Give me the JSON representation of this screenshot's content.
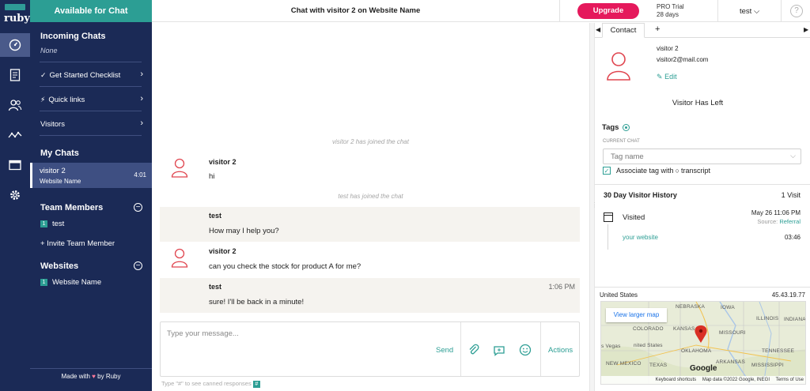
{
  "brand": {
    "badge": "",
    "name": "ruby"
  },
  "sidebar": {
    "header": "Available for Chat",
    "incoming_title": "Incoming Chats",
    "incoming_empty": "None",
    "menu": [
      {
        "label": "Get Started Checklist",
        "icon": "check-icon"
      },
      {
        "label": "Quick links",
        "icon": "bolt-icon"
      },
      {
        "label": "Visitors",
        "icon": ""
      }
    ],
    "my_chats_title": "My Chats",
    "active_chat": {
      "name": "visitor 2",
      "site": "Website Name",
      "time": "4:01"
    },
    "team_title": "Team Members",
    "team": [
      {
        "name": "test",
        "badge": "1"
      }
    ],
    "invite_label": "+ Invite Team Member",
    "websites_title": "Websites",
    "websites": [
      {
        "name": "Website Name",
        "badge": "1"
      }
    ],
    "footer_made": "Made with",
    "footer_by": "by Ruby"
  },
  "topbar": {
    "chat_title": "Chat with visitor 2 on Website Name",
    "upgrade_label": "Upgrade",
    "plan": "PRO Trial",
    "trial_days": "28 days",
    "user": "test",
    "help": "?"
  },
  "chat": {
    "system_messages": [
      "visitor 2 has joined the chat",
      "test has joined the chat"
    ],
    "messages": [
      {
        "author": "visitor 2",
        "text": "hi",
        "role": "visitor",
        "time": ""
      },
      {
        "author": "test",
        "text": "How may I help you?",
        "role": "agent",
        "time": ""
      },
      {
        "author": "visitor 2",
        "text": "can you check the stock for product A for me?",
        "role": "visitor",
        "time": ""
      },
      {
        "author": "test",
        "text": "sure! I'll be back in a minute!",
        "role": "agent",
        "time": "1:06 PM"
      }
    ],
    "composer_placeholder": "Type your message...",
    "send_label": "Send",
    "actions_label": "Actions",
    "hint_text": "Type \"#\" to see canned responses",
    "hint_badge": "#"
  },
  "contact": {
    "tab_label": "Contact",
    "add_tab": "+",
    "name": "visitor 2",
    "email": "visitor2@mail.com",
    "edit_label": "Edit",
    "status": "Visitor Has Left",
    "tags_title": "Tags",
    "current_chat_label": "CURRENT CHAT",
    "tag_placeholder": "Tag name",
    "associate_label": "Associate tag with",
    "associate_suffix": "transcript",
    "history_title": "30 Day Visitor History",
    "history_count": "1 Visit",
    "visit_label": "Visited",
    "visit_date": "May 26 11:06 PM",
    "source_label": "Source:",
    "source_value": "Referral",
    "visit_site": "your website",
    "visit_time": "03:46",
    "country": "United States",
    "ip": "45.43.19.77"
  },
  "map": {
    "view_larger": "View larger map",
    "labels": [
      "NEBRASKA",
      "IOWA",
      "ILLINOIS",
      "INDIANA",
      "COLORADO",
      "KANSAS",
      "MISSOURI",
      "OKLAHOMA",
      "TENNESSEE",
      "NEW MEXICO",
      "TEXAS",
      "ARKANSAS",
      "MISSISSIPPI",
      "s Vegas",
      "nited States"
    ],
    "google": "Google",
    "credits": [
      "Keyboard shortcuts",
      "Map data ©2022 Google, INEGI",
      "Terms of Use"
    ]
  },
  "colors": {
    "sidebar": "#1b2a56",
    "accent": "#2c9e94",
    "upgrade": "#e5195c",
    "avatar": "#e0454f"
  }
}
